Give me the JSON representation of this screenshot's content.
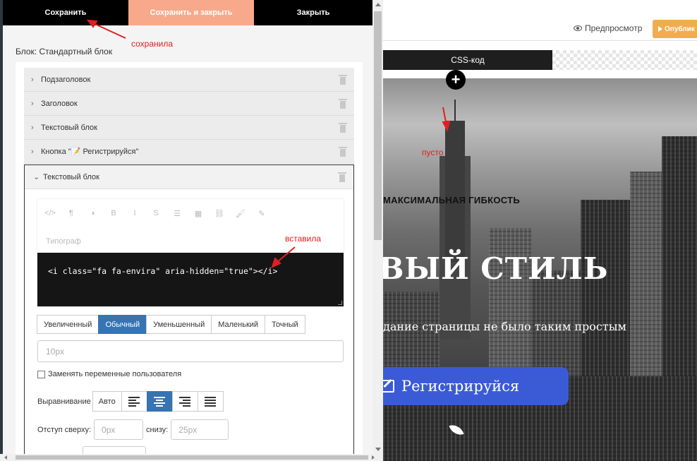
{
  "toolbar": {
    "save": "Сохранить",
    "save_close": "Сохранить и закрыть",
    "close": "Закрыть"
  },
  "block": {
    "title": "Блок: Стандартный блок",
    "items": [
      {
        "label": "Подзаголовок"
      },
      {
        "label": "Заголовок"
      },
      {
        "label": "Текстовый блок"
      },
      {
        "label": "Кнопка \"📝 Регистрируйся\""
      }
    ],
    "open_item": {
      "label": "Текстовый блок",
      "typograph_placeholder": "Типограф",
      "code": "<i class=\"fa fa-envira\" aria-hidden=\"true\"></i>",
      "toolbar_icons": [
        "code-icon",
        "paragraph-icon",
        "contrast-icon",
        "bold-icon",
        "italic-icon",
        "strike-icon",
        "list-icon",
        "table-icon",
        "link-icon",
        "brush-icon",
        "pen-icon"
      ],
      "toolbar_glyphs": [
        "</>",
        "¶",
        "◑",
        "B",
        "I",
        "S",
        "☰",
        "▦",
        "⛓",
        "🖌",
        "✎"
      ],
      "sizes": [
        "Увеличенный",
        "Обычный",
        "Уменьшенный",
        "Маленький",
        "Точный"
      ],
      "size_selected": "Обычный",
      "font_size_value": "10px",
      "replace_vars_label": "Заменять переменные пользователя",
      "align_label": "Выравнивание",
      "align_auto": "Авто",
      "align_selected": "center",
      "padding_top_label": "Отступ сверху:",
      "padding_top_placeholder": "0px",
      "padding_bottom_label": "снизу:",
      "padding_bottom_placeholder": "25px"
    }
  },
  "preview": {
    "preview_label": "Предпросмотр",
    "publish_label": "Опублик",
    "css_tab": "CSS-код",
    "plus": "+",
    "subtitle": "МАКСИМАЛЬНАЯ ГИБКОСТЬ",
    "title": "ВЫЙ СТИЛЬ",
    "description": "дание страницы не было таким простым",
    "button": "Регистрируйся"
  },
  "annotations": {
    "saved": "сохранила",
    "inserted": "вставила",
    "empty": "пусто"
  },
  "colors": {
    "accent_blue": "#3674b3",
    "save_close_bg": "#f9a98b",
    "publish_bg": "#f0ad4e",
    "hero_button": "#3b5bd6",
    "annotation_red": "#e02020"
  }
}
